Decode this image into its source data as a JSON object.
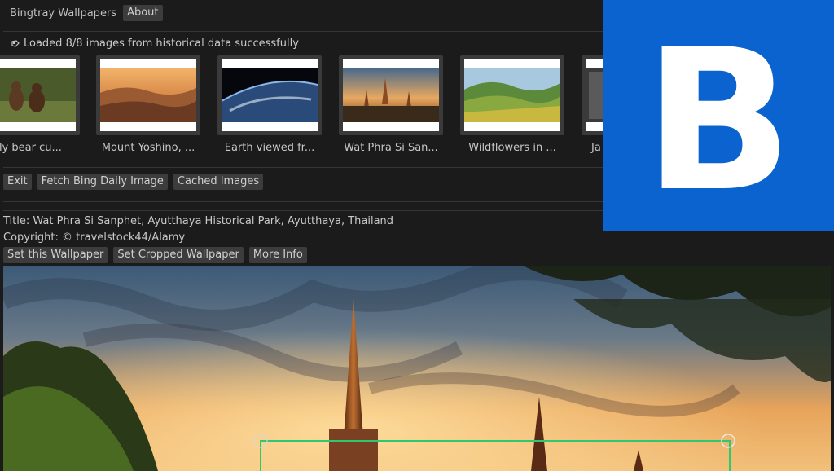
{
  "app": {
    "title": "Bingtray Wallpapers",
    "about_label": "About"
  },
  "status": {
    "icon": "loaded-tag-icon",
    "text": "Loaded 8/8 images from historical data successfully"
  },
  "gallery": {
    "thumbnails": [
      {
        "caption": "zly bear cu..."
      },
      {
        "caption": "Mount Yoshino, ..."
      },
      {
        "caption": "Earth viewed fr..."
      },
      {
        "caption": "Wat Phra Si San..."
      },
      {
        "caption": "Wildflowers in ..."
      },
      {
        "caption": "Ja"
      }
    ]
  },
  "actions": {
    "exit_label": "Exit",
    "fetch_label": "Fetch Bing Daily Image",
    "cached_label": "Cached Images"
  },
  "selected": {
    "title": "Title: Wat Phra Si Sanphet, Ayutthaya Historical Park, Ayutthaya, Thailand",
    "copyright": "Copyright: © travelstock44/Alamy"
  },
  "wallpaper_actions": {
    "set_label": "Set this Wallpaper",
    "set_cropped_label": "Set Cropped Wallpaper",
    "more_info_label": "More Info"
  },
  "logo": {
    "letter": "B",
    "color": "#0a63cf"
  },
  "colors": {
    "background": "#1b1b1b",
    "button": "#3c3c3c",
    "crop_border": "#2ec870"
  }
}
